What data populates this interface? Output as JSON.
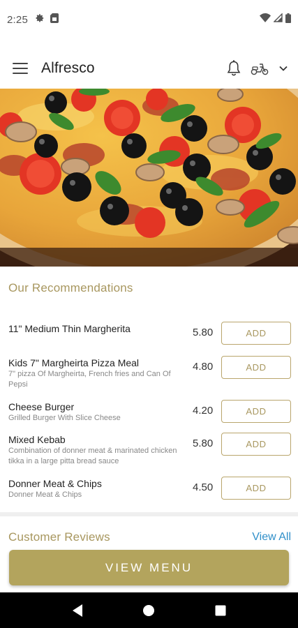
{
  "status_bar": {
    "time": "2:25",
    "left_icons": [
      "gear-icon",
      "sim-card-icon"
    ],
    "right_icons": [
      "wifi-icon",
      "signal-icon",
      "battery-icon"
    ]
  },
  "app_bar": {
    "title": "Alfresco",
    "icons": [
      "menu-icon",
      "bell-icon",
      "scooter-icon",
      "chevron-down-icon"
    ]
  },
  "hero": {
    "image": "pizza-photo"
  },
  "recommendations": {
    "title": "Our Recommendations",
    "items": [
      {
        "name": "11\" Medium Thin Margherita",
        "description": "",
        "price": "5.80",
        "add_label": "ADD"
      },
      {
        "name": "Kids 7\" Margheirta Pizza Meal",
        "description": "7\" pizza Of Margheirta, French fries and Can Of Pepsi",
        "price": "4.80",
        "add_label": "ADD"
      },
      {
        "name": "Cheese Burger",
        "description": "Grilled Burger With Slice Cheese",
        "price": "4.20",
        "add_label": "ADD"
      },
      {
        "name": "Mixed Kebab",
        "description": "Combination of donner meat & marinated chicken tikka in a large pitta bread sauce",
        "price": "5.80",
        "add_label": "ADD"
      },
      {
        "name": "Donner Meat & Chips",
        "description": "Donner Meat & Chips",
        "price": "4.50",
        "add_label": "ADD"
      }
    ]
  },
  "reviews": {
    "title": "Customer Reviews",
    "view_all_label": "View All"
  },
  "view_menu_label": "VIEW MENU",
  "colors": {
    "accent_gold": "#b3a45d",
    "section_title": "#a8975f",
    "link_blue": "#2f8fc9"
  },
  "nav_bar": {
    "buttons": [
      "back-icon",
      "home-icon",
      "recents-icon"
    ]
  }
}
